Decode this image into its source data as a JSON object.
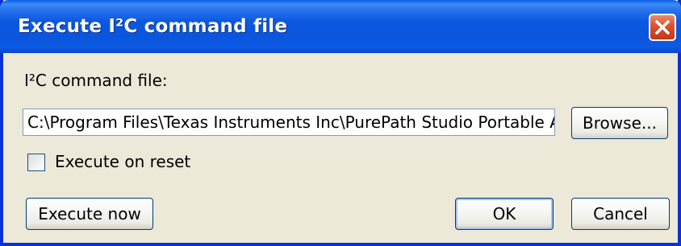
{
  "dialog": {
    "title": "Execute I²C command file",
    "close_icon": "close-icon"
  },
  "file_section": {
    "label": "I²C command file:",
    "path_value": "C:\\Program Files\\Texas Instruments Inc\\PurePath Studio Portable A",
    "browse_label": "Browse..."
  },
  "options": {
    "execute_on_reset_label": "Execute on reset",
    "execute_on_reset_checked": false
  },
  "buttons": {
    "execute_now_label": "Execute now",
    "ok_label": "OK",
    "cancel_label": "Cancel"
  },
  "colors": {
    "titlebar": "#0a55dc",
    "frame": "#0831d9",
    "dialog_bg": "#ece9d8",
    "close_button": "#d9522a"
  }
}
